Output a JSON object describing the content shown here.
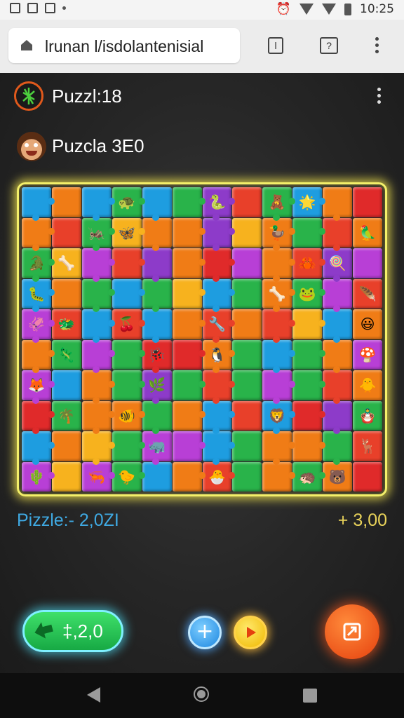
{
  "status_bar": {
    "time": "10:25"
  },
  "browser": {
    "url": "lrunan l/isdolantenisial",
    "tab_count": "l",
    "help_label": "?"
  },
  "app": {
    "title_main": "Puzzl:18",
    "title_player": "Puzcla 3E0",
    "stat_left": "Pizzle:- 2,0ZI",
    "stat_right": "+ 3,00",
    "coin_label": "‡,2,0"
  },
  "colors": {
    "accent_board_glow": "#f4f06a",
    "stat_left": "#3fa9e2",
    "stat_right": "#e9d35a",
    "coin_button": "#17a944",
    "share_button": "#e5400e"
  },
  "board": {
    "columns": 12,
    "rows": 10,
    "piece_colors": [
      "#1e9de0",
      "#f07c16",
      "#1e9de0",
      "#29b34a",
      "#1e9de0",
      "#29b34a",
      "#8d3bc9",
      "#e8402a",
      "#29b34a",
      "#1e9de0",
      "#f07c16",
      "#e02a2a",
      "#f07c16",
      "#e8402a",
      "#29b34a",
      "#f7b21e",
      "#f07c16",
      "#f07c16",
      "#8d3bc9",
      "#f7b21e",
      "#f07c16",
      "#29b34a",
      "#e8402a",
      "#f07c16",
      "#29b34a",
      "#f7b21e",
      "#b83fd6",
      "#e8402a",
      "#8d3bc9",
      "#f07c16",
      "#e02a2a",
      "#b83fd6",
      "#f07c16",
      "#e8402a",
      "#8d3bc9",
      "#b83fd6",
      "#1e9de0",
      "#f07c16",
      "#29b34a",
      "#1e9de0",
      "#29b34a",
      "#f7b21e",
      "#1e9de0",
      "#29b34a",
      "#f07c16",
      "#29b34a",
      "#b83fd6",
      "#e8402a",
      "#b83fd6",
      "#e8402a",
      "#1e9de0",
      "#e8402a",
      "#1e9de0",
      "#f07c16",
      "#e8402a",
      "#f07c16",
      "#e8402a",
      "#f7b21e",
      "#1e9de0",
      "#f07c16",
      "#f07c16",
      "#29b34a",
      "#b83fd6",
      "#29b34a",
      "#e02a2a",
      "#e02a2a",
      "#f07c16",
      "#29b34a",
      "#1e9de0",
      "#29b34a",
      "#f07c16",
      "#b83fd6",
      "#b83fd6",
      "#1e9de0",
      "#f07c16",
      "#29b34a",
      "#8d3bc9",
      "#29b34a",
      "#e8402a",
      "#29b34a",
      "#b83fd6",
      "#29b34a",
      "#e8402a",
      "#f07c16",
      "#e02a2a",
      "#29b34a",
      "#f07c16",
      "#f07c16",
      "#29b34a",
      "#f07c16",
      "#1e9de0",
      "#e8402a",
      "#1e9de0",
      "#e02a2a",
      "#8d3bc9",
      "#29b34a",
      "#1e9de0",
      "#f07c16",
      "#f7b21e",
      "#29b34a",
      "#b83fd6",
      "#b83fd6",
      "#1e9de0",
      "#29b34a",
      "#f07c16",
      "#f07c16",
      "#29b34a",
      "#e8402a",
      "#b83fd6",
      "#f7b21e",
      "#b83fd6",
      "#29b34a",
      "#1e9de0",
      "#f07c16",
      "#e8402a",
      "#29b34a",
      "#f07c16",
      "#29b34a",
      "#f07c16",
      "#e02a2a"
    ],
    "piece_glyphs": {
      "3": "🐢",
      "6": "🐍",
      "8": "🧸",
      "9": "🌟",
      "14": "🦗",
      "15": "🦋",
      "20": "🦆",
      "23": "🦜",
      "24": "🐊",
      "25": "🦴",
      "33": "🦀",
      "34": "🍭",
      "36": "🐛",
      "44": "🦴",
      "45": "🐸",
      "47": "🪶",
      "48": "🦑",
      "49": "🐲",
      "51": "🍒",
      "54": "🔧",
      "59": "😃",
      "61": "🦎",
      "64": "🐞",
      "66": "🐧",
      "71": "🍄",
      "72": "🦊",
      "76": "🌿",
      "83": "🐥",
      "85": "🌴",
      "87": "🐠",
      "92": "🦁",
      "95": "🪆",
      "100": "🦏",
      "107": "🦌",
      "108": "🌵",
      "110": "🦐",
      "117": "🦔",
      "114": "🐣",
      "118": "🐻",
      "111": "🐤"
    }
  }
}
